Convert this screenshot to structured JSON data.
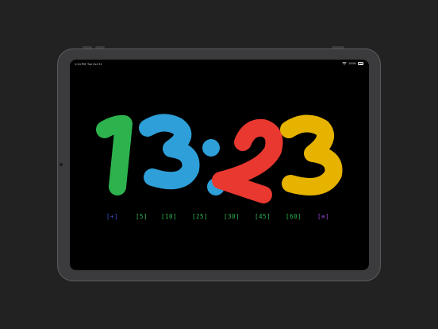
{
  "status_bar": {
    "time": "1:24 PM",
    "date": "Tue Oct 31",
    "battery": "100%",
    "wifi_icon": "wifi-icon",
    "battery_icon": "battery-icon"
  },
  "clock": {
    "digits": [
      "1",
      "3",
      ":",
      "2",
      "3"
    ],
    "colors": {
      "d1": "#2db34e",
      "d2": "#2e9fd8",
      "colon": "#2e9fd8",
      "d3": "#e8382f",
      "d4": "#edb900"
    }
  },
  "controls": [
    {
      "label": "[+]",
      "color": "#3a56d6"
    },
    {
      "label": "[5]",
      "color": "#2db34e"
    },
    {
      "label": "[10]",
      "color": "#2db34e"
    },
    {
      "label": "[25]",
      "color": "#2db34e"
    },
    {
      "label": "[30]",
      "color": "#2db34e"
    },
    {
      "label": "[45]",
      "color": "#2db34e"
    },
    {
      "label": "[60]",
      "color": "#2db34e"
    },
    {
      "label": "[≡]",
      "color": "#8e44c9"
    }
  ]
}
